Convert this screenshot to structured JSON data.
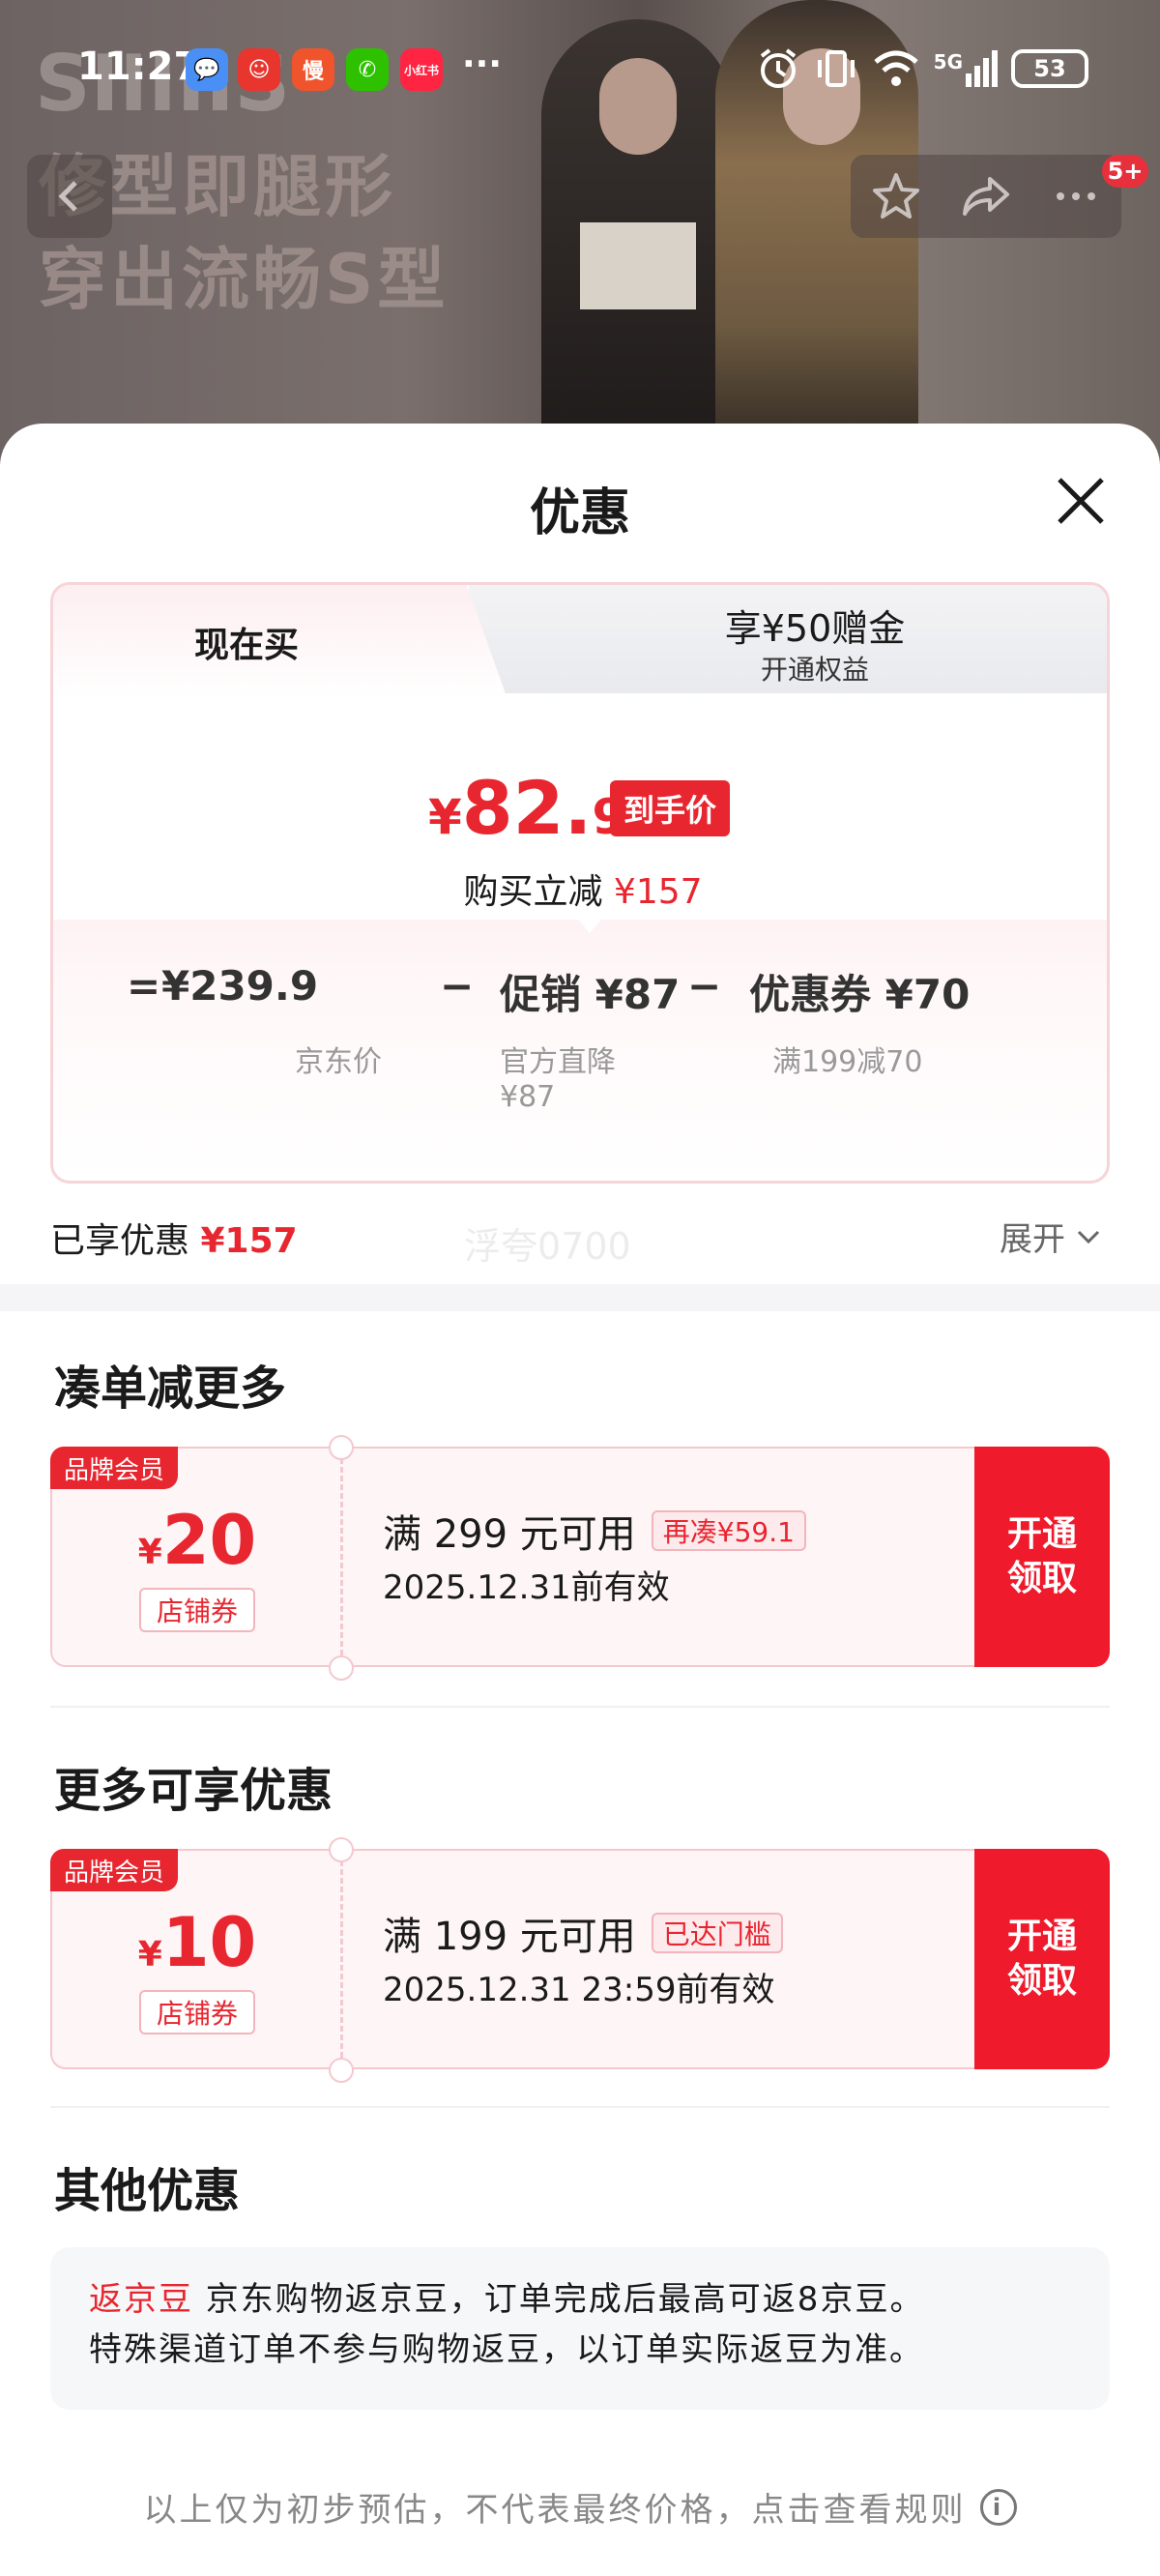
{
  "status_bar": {
    "time": "11:27",
    "app_icons": [
      {
        "name": "messages-icon",
        "glyph": "💬",
        "color": "#4a8ff5"
      },
      {
        "name": "cartoon-app-icon",
        "glyph": "☺",
        "color": "#e8362f"
      },
      {
        "name": "slow-app-icon",
        "glyph": "慢",
        "color": "#f0542d"
      },
      {
        "name": "wechat-icon",
        "glyph": "✆",
        "color": "#2dc100"
      },
      {
        "name": "xiaohongshu-icon",
        "glyph": "小红书",
        "color": "#ff2442"
      }
    ],
    "more": "···",
    "network": "5G",
    "battery": "53"
  },
  "hero": {
    "brand_text": "SIIIIIS",
    "slogan_line1": "修型即腿形",
    "slogan_line2": "穿出流畅S型"
  },
  "nav": {
    "badge": "5+"
  },
  "sheet": {
    "title": "优惠"
  },
  "price_card": {
    "tab_now": "现在买",
    "tab_member_title": "享¥50赠金",
    "tab_member_sub": "开通权益",
    "final_symbol": "¥",
    "final_int": "82.",
    "final_dec": "9",
    "final_tag": "到手价",
    "save_prefix": "购买立减",
    "save_value": "¥157",
    "formula": {
      "eq": "=",
      "jd_price": "¥239.9",
      "minus1": "−",
      "promo": "促销 ¥87",
      "minus2": "−",
      "coupon": "优惠券 ¥70",
      "jd_price_label": "京东价",
      "promo_label_1": "官方直降",
      "promo_label_2": "¥87",
      "coupon_label": "满199减70"
    }
  },
  "enjoyed": {
    "label": "已享优惠",
    "value": "¥157",
    "expand": "展开",
    "watermark": "浮夸0700"
  },
  "sections": {
    "more_discount": "凑单减更多",
    "more_offers": "更多可享优惠",
    "other": "其他优惠"
  },
  "coupons": [
    {
      "brand_tag": "品牌会员",
      "symbol": "¥",
      "amount": "20",
      "type": "店铺券",
      "condition": "满 299 元可用",
      "cond_tag": "再凑¥59.1",
      "valid": "2025.12.31前有效",
      "action_line1": "开通",
      "action_line2": "领取"
    },
    {
      "brand_tag": "品牌会员",
      "symbol": "¥",
      "amount": "10",
      "type": "店铺券",
      "condition": "满 199 元可用",
      "cond_tag": "已达门槛",
      "valid": "2025.12.31 23:59前有效",
      "action_line1": "开通",
      "action_line2": "领取"
    }
  ],
  "other": {
    "label": "返京豆",
    "text1": " 京东购物返京豆，订单完成后最高可返8京豆。",
    "text2": "特殊渠道订单不参与购物返豆，以订单实际返豆为准。"
  },
  "disclaimer": {
    "text": "以上仅为初步预估，不代表最终价格，点击查看规则",
    "icon": "i"
  },
  "colors": {
    "accent_red": "#e8262f",
    "action_red": "#ef1a2b",
    "coupon_bg": "#fdf5f6"
  }
}
